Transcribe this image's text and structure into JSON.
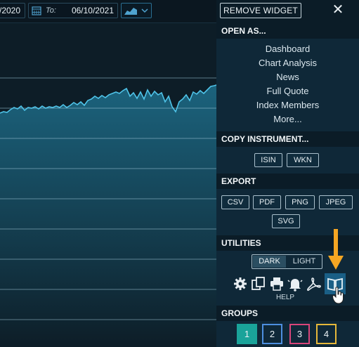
{
  "toolbar": {
    "from_value": "/2020",
    "to_label": "To:",
    "to_value": "06/10/2021"
  },
  "panel": {
    "remove_widget": "REMOVE WIDGET",
    "close_glyph": "✕",
    "open_as": {
      "title": "OPEN AS...",
      "items": [
        "Dashboard",
        "Chart Analysis",
        "News",
        "Full Quote",
        "Index Members",
        "More..."
      ]
    },
    "copy_instrument": {
      "title": "COPY INSTRUMENT...",
      "buttons": [
        "ISIN",
        "WKN"
      ]
    },
    "export": {
      "title": "EXPORT",
      "buttons": [
        "CSV",
        "PDF",
        "PNG",
        "JPEG",
        "SVG"
      ]
    },
    "utilities": {
      "title": "UTILITIES",
      "dark_label": "DARK",
      "light_label": "LIGHT",
      "icons": [
        "settings-icon",
        "copy-icon",
        "print-icon",
        "alert-bell-icon",
        "pdf-icon",
        "help-book-icon"
      ],
      "help_label": "HELP"
    },
    "groups": {
      "title": "GROUPS",
      "items": [
        {
          "label": "1",
          "color": "#1aa39a",
          "active": true
        },
        {
          "label": "2",
          "color": "#4d8fe0",
          "active": false
        },
        {
          "label": "3",
          "color": "#d9457a",
          "active": false
        },
        {
          "label": "4",
          "color": "#e6b83a",
          "active": false
        }
      ]
    }
  },
  "colors": {
    "accent_arrow": "#f5a623",
    "line": "#4fc3e8"
  }
}
